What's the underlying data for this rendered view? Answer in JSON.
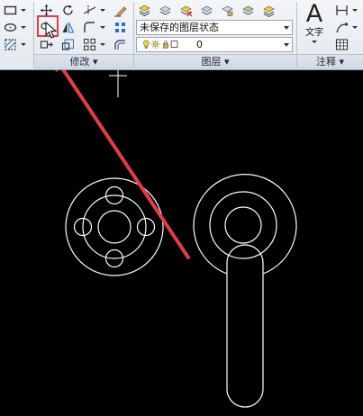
{
  "ribbon": {
    "modify_panel": {
      "title": "修改 ▾"
    },
    "layer_panel": {
      "title": "图层 ▾",
      "layer_state": "未保存的图层状态",
      "current_layer": "0"
    },
    "annotation_panel": {
      "title": "注释 ▾",
      "text_tool_glyph": "A",
      "text_tool_label": "文字"
    }
  },
  "colors": {
    "canvas_background": "#000000",
    "linework": "#ffffff",
    "annotation": "#e43d3d",
    "layer_bulb": "#f2d321"
  },
  "icons": [
    "rectangle-icon",
    "ellipse-icon",
    "hatch-icon",
    "move-icon",
    "rotate-icon",
    "trim-icon",
    "erase-icon",
    "copy-icon",
    "mirror-icon",
    "fillet-icon",
    "explode-icon",
    "stretch-icon",
    "scale-icon",
    "array-icon",
    "offset-icon",
    "layer-properties-icon",
    "layer-icon",
    "layer-off-icon",
    "layer-freeze-icon",
    "layer-lock-icon",
    "layer-match-icon",
    "text-icon",
    "dimension-icon",
    "leader-icon",
    "table-icon",
    "cursor-icon",
    "arrow-annotation"
  ]
}
